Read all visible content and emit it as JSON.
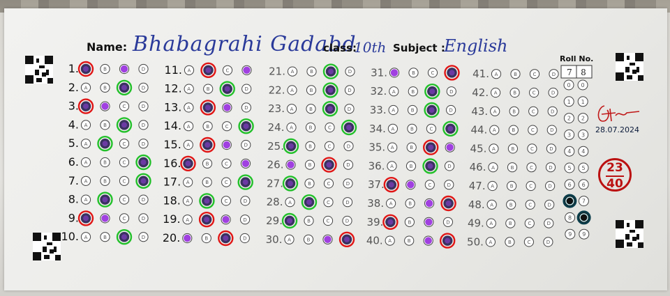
{
  "header": {
    "name_label": "Name:",
    "name_value": "Bhabagrahi Gadabd",
    "class_label": "class:",
    "class_value": "10th",
    "subject_label": "Subject :",
    "subject_value": "English"
  },
  "roll": {
    "title": "Roll No.",
    "digits": [
      "7",
      "8"
    ],
    "marked": [
      7,
      8
    ]
  },
  "grading": {
    "score": "23",
    "total": "40",
    "date": "28.07.2024"
  },
  "option_letters": [
    "A",
    "B",
    "C",
    "D"
  ],
  "colors": {
    "correct": "#22c02a",
    "wrong": "#e01515",
    "key_dot": "#a040e0",
    "fill": "#3a3260",
    "roll_mark": "#0b3d4a"
  },
  "questions": [
    {
      "n": "1.",
      "filled": 0,
      "status": "wrong",
      "key": 2
    },
    {
      "n": "2.",
      "filled": 2,
      "status": "correct",
      "key": null
    },
    {
      "n": "3.",
      "filled": 0,
      "status": "wrong",
      "key": 1
    },
    {
      "n": "4.",
      "filled": 2,
      "status": "correct",
      "key": null
    },
    {
      "n": "5.",
      "filled": 1,
      "status": "correct",
      "key": null
    },
    {
      "n": "6.",
      "filled": 3,
      "status": "correct",
      "key": null
    },
    {
      "n": "7.",
      "filled": 3,
      "status": "correct",
      "key": null
    },
    {
      "n": "8.",
      "filled": 1,
      "status": "correct",
      "key": null
    },
    {
      "n": "9.",
      "filled": 0,
      "status": "wrong",
      "key": 1
    },
    {
      "n": "10.",
      "filled": 2,
      "status": "correct",
      "key": null
    },
    {
      "n": "11.",
      "filled": 1,
      "status": "wrong",
      "key": 3
    },
    {
      "n": "12.",
      "filled": 2,
      "status": "correct",
      "key": null
    },
    {
      "n": "13.",
      "filled": 1,
      "status": "wrong",
      "key": 2
    },
    {
      "n": "14.",
      "filled": 3,
      "status": "correct",
      "key": null
    },
    {
      "n": "15.",
      "filled": 1,
      "status": "wrong",
      "key": 2
    },
    {
      "n": "16.",
      "filled": 0,
      "status": "wrong",
      "key": 3
    },
    {
      "n": "17.",
      "filled": 3,
      "status": "correct",
      "key": null
    },
    {
      "n": "18.",
      "filled": 1,
      "status": "correct",
      "key": null
    },
    {
      "n": "19.",
      "filled": 1,
      "status": "wrong",
      "key": 2
    },
    {
      "n": "20.",
      "filled": 2,
      "status": "wrong",
      "key": 0
    },
    {
      "n": "21.",
      "filled": 2,
      "status": "correct",
      "key": null
    },
    {
      "n": "22.",
      "filled": 2,
      "status": "correct",
      "key": null
    },
    {
      "n": "23.",
      "filled": 2,
      "status": "correct",
      "key": null
    },
    {
      "n": "24.",
      "filled": 3,
      "status": "correct",
      "key": null
    },
    {
      "n": "25.",
      "filled": 0,
      "status": "correct",
      "key": null
    },
    {
      "n": "26.",
      "filled": 2,
      "status": "wrong",
      "key": 0
    },
    {
      "n": "27.",
      "filled": 0,
      "status": "correct",
      "key": null
    },
    {
      "n": "28.",
      "filled": 1,
      "status": "correct",
      "key": null
    },
    {
      "n": "29.",
      "filled": 0,
      "status": "correct",
      "key": null
    },
    {
      "n": "30.",
      "filled": 3,
      "status": "wrong",
      "key": 2
    },
    {
      "n": "31.",
      "filled": 3,
      "status": "wrong",
      "key": 0
    },
    {
      "n": "32.",
      "filled": 2,
      "status": "correct",
      "key": null
    },
    {
      "n": "33.",
      "filled": 2,
      "status": "correct",
      "key": null
    },
    {
      "n": "34.",
      "filled": 3,
      "status": "correct",
      "key": null
    },
    {
      "n": "35.",
      "filled": 2,
      "status": "wrong",
      "key": 3
    },
    {
      "n": "36.",
      "filled": 2,
      "status": "correct",
      "key": null
    },
    {
      "n": "37.",
      "filled": 0,
      "status": "wrong",
      "key": 1
    },
    {
      "n": "38.",
      "filled": 3,
      "status": "wrong",
      "key": 2
    },
    {
      "n": "39.",
      "filled": 0,
      "status": "wrong",
      "key": 2
    },
    {
      "n": "40.",
      "filled": 3,
      "status": "wrong",
      "key": 2
    },
    {
      "n": "41.",
      "filled": null,
      "status": "blank",
      "key": null
    },
    {
      "n": "42.",
      "filled": null,
      "status": "blank",
      "key": null
    },
    {
      "n": "43.",
      "filled": null,
      "status": "blank",
      "key": null
    },
    {
      "n": "44.",
      "filled": null,
      "status": "blank",
      "key": null
    },
    {
      "n": "45.",
      "filled": null,
      "status": "blank",
      "key": null
    },
    {
      "n": "46.",
      "filled": null,
      "status": "blank",
      "key": null
    },
    {
      "n": "47.",
      "filled": null,
      "status": "blank",
      "key": null
    },
    {
      "n": "48.",
      "filled": null,
      "status": "blank",
      "key": null
    },
    {
      "n": "49.",
      "filled": null,
      "status": "blank",
      "key": null
    },
    {
      "n": "50.",
      "filled": null,
      "status": "blank",
      "key": null
    }
  ]
}
